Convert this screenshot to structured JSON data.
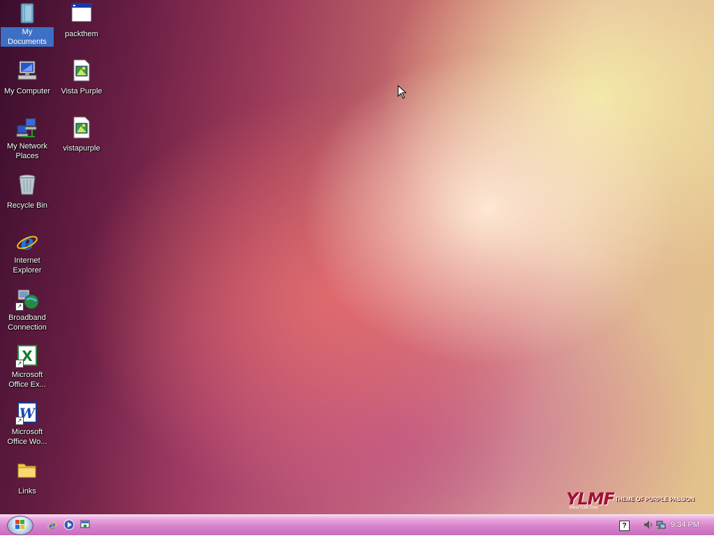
{
  "desktop": {
    "icons": [
      {
        "label": "My Documents",
        "icon": "my-documents-icon",
        "selected": true
      },
      {
        "label": "My Computer",
        "icon": "my-computer-icon"
      },
      {
        "label": "My Network Places",
        "icon": "network-places-icon"
      },
      {
        "label": "Recycle Bin",
        "icon": "recycle-bin-icon"
      },
      {
        "label": "Internet Explorer",
        "icon": "internet-explorer-icon"
      },
      {
        "label": "Broadband Connection",
        "icon": "broadband-connection-icon"
      },
      {
        "label": "Microsoft Office Ex...",
        "icon": "excel-icon"
      },
      {
        "label": "Microsoft Office Wo...",
        "icon": "word-icon"
      },
      {
        "label": "Links",
        "icon": "folder-icon"
      },
      {
        "label": "packthem",
        "icon": "application-window-icon"
      },
      {
        "label": "Vista Purple",
        "icon": "image-file-icon"
      },
      {
        "label": "vistapurple",
        "icon": "image-file-icon"
      }
    ],
    "logo": {
      "mark": "YLMF",
      "tagline": "THEME OF PURPLE PASSION",
      "site": "WWW.YLMF.COM"
    }
  },
  "taskbar": {
    "quick_launch": [
      "internet-explorer-icon",
      "media-player-icon",
      "show-desktop-icon"
    ],
    "tray": {
      "help": "?",
      "icons": [
        "speaker-icon",
        "network-icon"
      ],
      "clock": "9:34 PM"
    }
  },
  "colors": {
    "selection": "#3d6fc4",
    "taskbar": "#d883cc"
  }
}
